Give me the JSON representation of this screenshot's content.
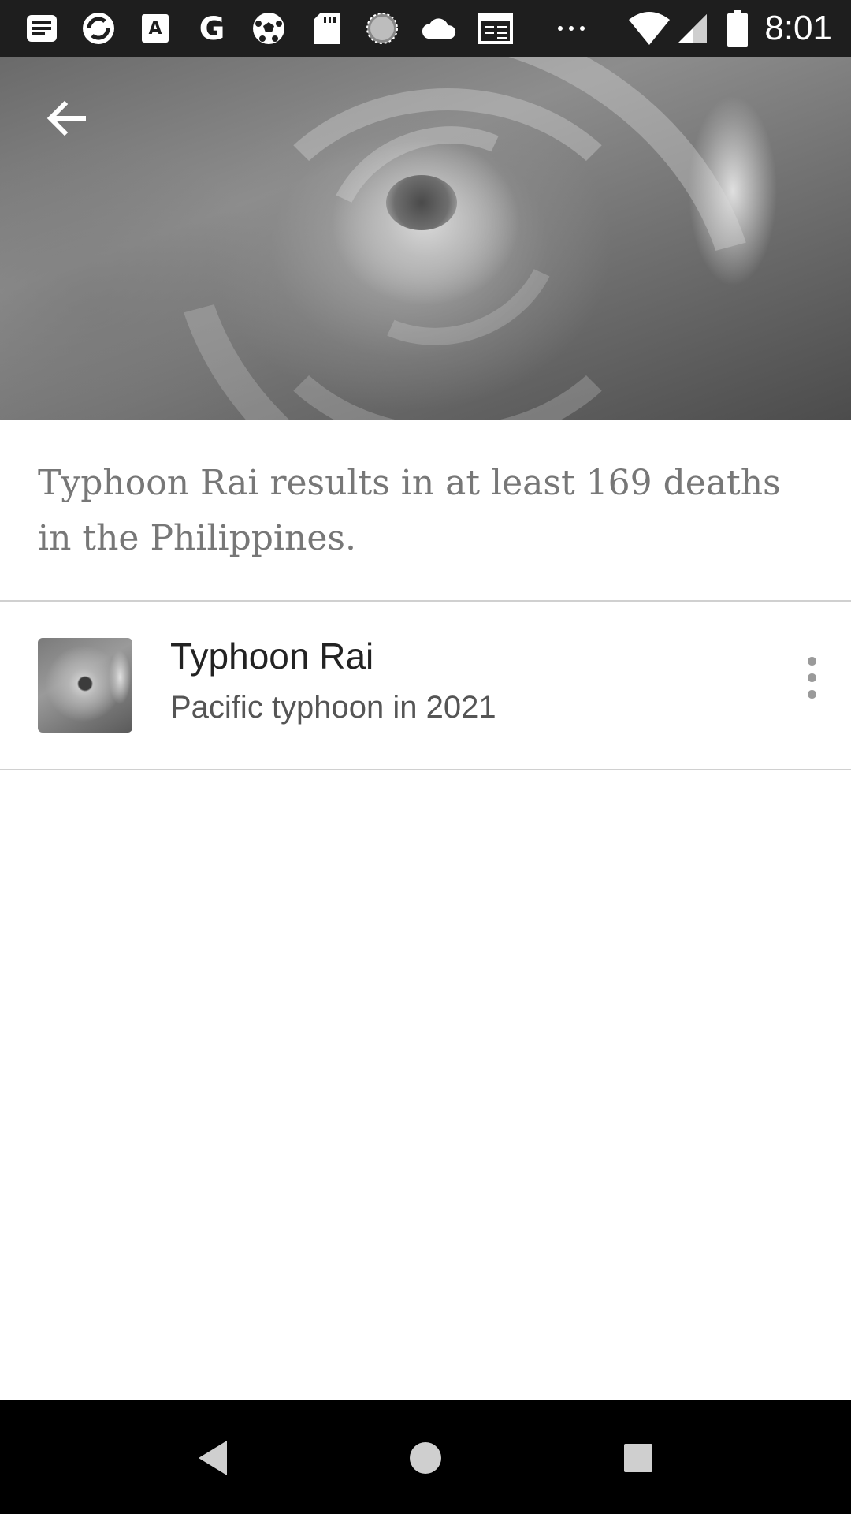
{
  "status_bar": {
    "time": "8:01",
    "notification_icons": [
      "notes-icon",
      "sync-icon",
      "translate-icon",
      "google-icon",
      "soccer-ball-icon",
      "sd-card-icon",
      "loading-icon",
      "cloud-icon",
      "news-icon",
      "more-notifications-icon"
    ],
    "system_icons": [
      "wifi-icon",
      "cellular-signal-icon",
      "battery-icon"
    ]
  },
  "header": {
    "back_icon": "arrow-back-icon"
  },
  "headline": {
    "text": "Typhoon Rai results in at least 169 deaths in the Philippines."
  },
  "related_article": {
    "title": "Typhoon Rai",
    "subtitle": "Pacific typhoon in 2021",
    "menu_icon": "more-vert-icon"
  },
  "nav_bar": {
    "buttons": [
      "back-nav-icon",
      "home-nav-icon",
      "recents-nav-icon"
    ]
  },
  "colors": {
    "status_bar_bg": "#1e1e1e",
    "headline_text": "#777777",
    "title_text": "#222222",
    "subtitle_text": "#555555",
    "divider": "#d0d0d0",
    "nav_bar_bg": "#000000"
  }
}
